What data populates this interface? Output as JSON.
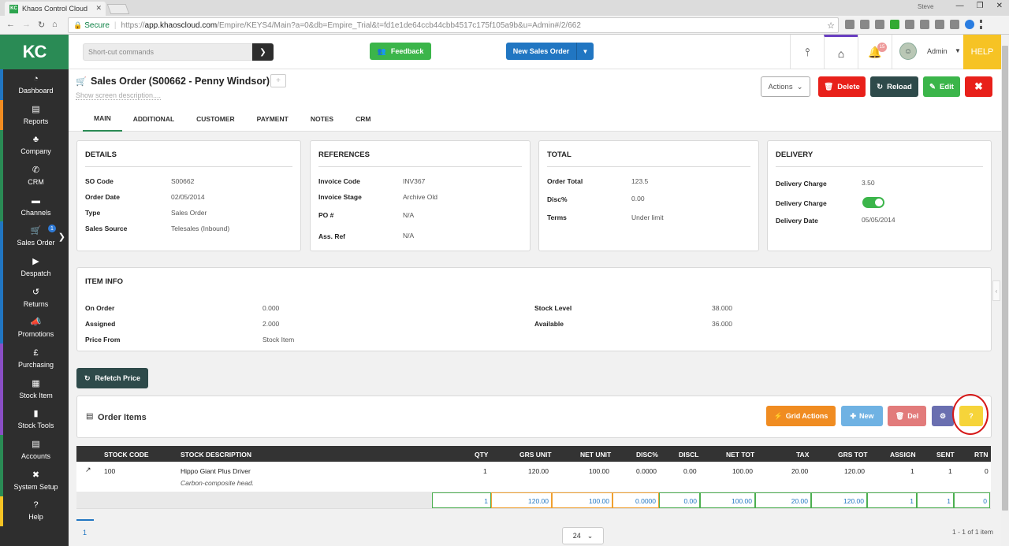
{
  "browser": {
    "tab_title": "Khaos Control Cloud",
    "tab_icon": "KC",
    "profile": "Steve",
    "secure_label": "Secure",
    "url_scheme": "https://",
    "url_host": "app.khaoscloud.com",
    "url_path": "/Empire/KEYS4/Main?a=0&db=Empire_Trial&t=fd1e1de64ccb44cbb4517c175f105a9b&u=Admin#/2/662"
  },
  "sidebar": {
    "logo": "KC",
    "items": [
      {
        "label": "Dashboard",
        "icon": "◔",
        "color": "#2176c2"
      },
      {
        "label": "Reports",
        "icon": "▤",
        "color": "#f08c21"
      },
      {
        "label": "Company",
        "icon": "♣",
        "color": "#2a8b55"
      },
      {
        "label": "CRM",
        "icon": "✆",
        "color": "#2a8b55"
      },
      {
        "label": "Channels",
        "icon": "▬",
        "color": "#2a8b55"
      },
      {
        "label": "Sales Order",
        "icon": "🛒",
        "color": "#2176c2",
        "badge": "1"
      },
      {
        "label": "Despatch",
        "icon": "▶",
        "color": "#2176c2"
      },
      {
        "label": "Returns",
        "icon": "↺",
        "color": "#2176c2"
      },
      {
        "label": "Promotions",
        "icon": "📣",
        "color": "#2176c2"
      },
      {
        "label": "Purchasing",
        "icon": "£",
        "color": "#8a4fc5"
      },
      {
        "label": "Stock Item",
        "icon": "▦",
        "color": "#8a4fc5"
      },
      {
        "label": "Stock Tools",
        "icon": "▮",
        "color": "#8a4fc5"
      },
      {
        "label": "Accounts",
        "icon": "▤",
        "color": "#2a8b55"
      },
      {
        "label": "System Setup",
        "icon": "✖",
        "color": "#2a8b55"
      },
      {
        "label": "Help",
        "icon": "?",
        "color": "#f6c324"
      }
    ]
  },
  "topbar": {
    "shortcut_placeholder": "Short-cut commands",
    "feedback_label": "Feedback",
    "new_order_label": "New Sales Order",
    "notification_count": "15",
    "user_label": "Admin",
    "help_label": "HELP"
  },
  "page": {
    "title": "Sales Order (S00662 - Penny Windsor)",
    "show_description": "Show screen description....",
    "actions_label": "Actions",
    "delete_label": "Delete",
    "reload_label": "Reload",
    "edit_label": "Edit",
    "tabs": [
      "MAIN",
      "ADDITIONAL",
      "CUSTOMER",
      "PAYMENT",
      "NOTES",
      "CRM"
    ]
  },
  "details": {
    "title": "DETAILS",
    "rows": [
      {
        "key": "SO Code",
        "value": "S00662"
      },
      {
        "key": "Order Date",
        "value": "02/05/2014"
      },
      {
        "key": "Type",
        "value": "Sales Order"
      },
      {
        "key": "Sales Source",
        "value": "Telesales (Inbound)"
      }
    ]
  },
  "references": {
    "title": "REFERENCES",
    "rows": [
      {
        "key": "Invoice Code",
        "value": "INV367"
      },
      {
        "key": "Invoice Stage",
        "value": "Archive Old"
      },
      {
        "key": "PO #",
        "value": "N/A"
      },
      {
        "key": "Ass. Ref",
        "value": "N/A"
      }
    ]
  },
  "total": {
    "title": "TOTAL",
    "rows": [
      {
        "key": "Order Total",
        "value": "123.5"
      },
      {
        "key": "Disc%",
        "value": "0.00"
      },
      {
        "key": "Terms",
        "value": "Under limit"
      }
    ]
  },
  "delivery": {
    "title": "DELIVERY",
    "charge_label": "Delivery Charge",
    "charge_value": "3.50",
    "charge_toggle_label": "Delivery Charge",
    "charge_toggle_on": true,
    "date_label": "Delivery Date",
    "date_value": "05/05/2014"
  },
  "item_info": {
    "title": "ITEM INFO",
    "left": [
      {
        "key": "On Order",
        "value": "0.000"
      },
      {
        "key": "Assigned",
        "value": "2.000"
      },
      {
        "key": "Price From",
        "value": "Stock Item"
      }
    ],
    "right": [
      {
        "key": "Stock Level",
        "value": "38.000"
      },
      {
        "key": "Available",
        "value": "36.000"
      }
    ]
  },
  "refetch_label": "Refetch Price",
  "order_items": {
    "title": "Order Items",
    "grid_actions_label": "Grid Actions",
    "new_label": "New",
    "del_label": "Del",
    "help_label": "?"
  },
  "grid": {
    "columns": [
      "STOCK CODE",
      "STOCK DESCRIPTION",
      "QTY",
      "GRS UNIT",
      "NET UNIT",
      "DISC%",
      "DISCL",
      "NET TOT",
      "TAX",
      "GRS TOT",
      "ASSIGN",
      "SENT",
      "RTN"
    ],
    "row": {
      "stock_code": "100",
      "description": "Hippo Giant Plus Driver",
      "sub_description": "Carbon-composite head.",
      "qty": "1",
      "grs_unit": "120.00",
      "net_unit": "100.00",
      "disc": "0.0000",
      "discl": "0.00",
      "net_tot": "100.00",
      "tax": "20.00",
      "grs_tot": "120.00",
      "assign": "1",
      "sent": "1",
      "rtn": "0"
    },
    "totals": {
      "qty": "1",
      "grs_unit": "120.00",
      "net_unit": "100.00",
      "disc": "0.0000",
      "discl": "0.00",
      "net_tot": "100.00",
      "tax": "20.00",
      "grs_tot": "120.00",
      "assign": "1",
      "sent": "1",
      "rtn": "0"
    }
  },
  "pager": {
    "current_page": "1",
    "page_size": "24",
    "summary": "1 - 1 of 1 item"
  }
}
